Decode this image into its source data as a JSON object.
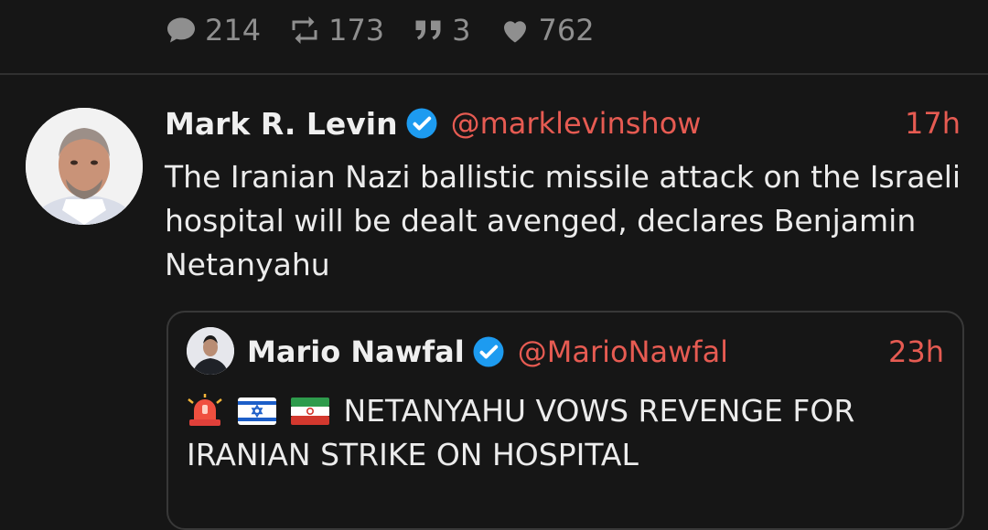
{
  "stats": {
    "replies": "214",
    "retweets": "173",
    "quotes": "3",
    "likes": "762"
  },
  "tweet": {
    "name": "Mark R. Levin",
    "handle": "@marklevinshow",
    "time": "17h",
    "text_line1": "The Iranian Nazi ballistic missile attack on the Israeli",
    "text_line2": "hospital will be dealt avenged, declares Benjamin",
    "text_line3": "Netanyahu"
  },
  "quoted": {
    "name": "Mario Nawfal",
    "handle": "@MarioNawfal",
    "time": "23h",
    "text_line1": "NETANYAHU VOWS REVENGE FOR",
    "text_line2": "IRANIAN STRIKE ON HOSPITAL",
    "emojis": [
      "rotating-light-icon",
      "israel-flag-icon",
      "iran-flag-icon"
    ]
  },
  "colors": {
    "background": "#161616",
    "accent": "#e65b52",
    "verified": "#1d9bf0",
    "muted": "#8f8f8f"
  }
}
